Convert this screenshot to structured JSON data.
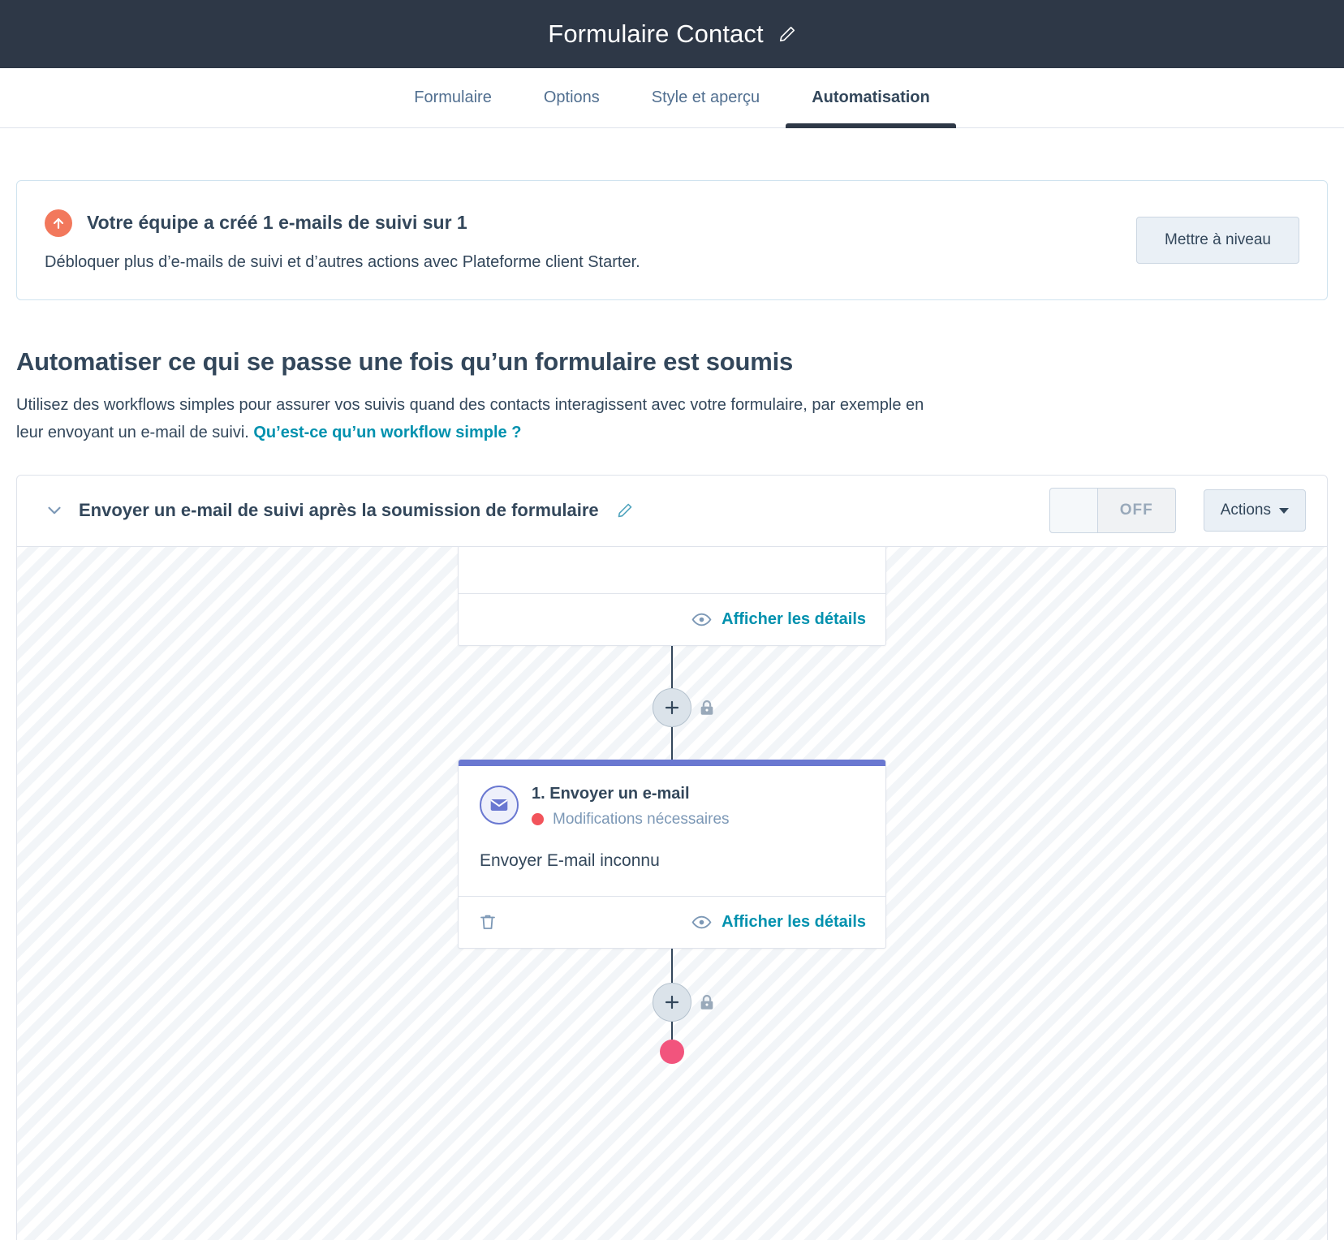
{
  "topbar": {
    "title": "Formulaire Contact",
    "edit_icon": "pencil-icon"
  },
  "tabs": [
    {
      "label": "Formulaire",
      "active": false
    },
    {
      "label": "Options",
      "active": false
    },
    {
      "label": "Style et aperçu",
      "active": false
    },
    {
      "label": "Automatisation",
      "active": true
    }
  ],
  "banner": {
    "icon": "arrow-up-circle-icon",
    "title": "Votre équipe a créé 1 e-mails de suivi sur 1",
    "subtitle": "Débloquer plus d’e-mails de suivi et d’autres actions avec  Plateforme client Starter.",
    "upgrade_label": "Mettre à niveau",
    "accent_color": "#f2785c"
  },
  "section": {
    "title": "Automatiser ce qui se passe une fois qu’un formulaire est soumis",
    "desc_part1": "Utilisez des workflows simples pour assurer vos suivis quand des contacts interagissent avec votre formulaire, par exemple en leur envoyant un e-mail de suivi. ",
    "link_label": "Qu’est-ce qu’un workflow simple ?",
    "link_color": "#0091ae"
  },
  "workflow": {
    "collapse_icon": "chevron-down-icon",
    "title": "Envoyer un e-mail de suivi après la soumission de formulaire",
    "edit_icon": "pencil-icon",
    "toggle_state": "OFF",
    "actions_label": "Actions",
    "canvas": {
      "top_card": {
        "details_label": "Afficher les détails",
        "eye_icon": "eye-icon"
      },
      "email_card": {
        "accent_color": "#6a78d1",
        "icon": "envelope-icon",
        "step_title": "1. Envoyer un e-mail",
        "status_label": "Modifications nécessaires",
        "status_color": "#f2545b",
        "body_text": "Envoyer E-mail inconnu",
        "delete_icon": "trash-icon",
        "details_label": "Afficher les détails",
        "eye_icon": "eye-icon"
      },
      "add_step_icon": "plus-icon",
      "lock_icon": "lock-icon"
    }
  }
}
